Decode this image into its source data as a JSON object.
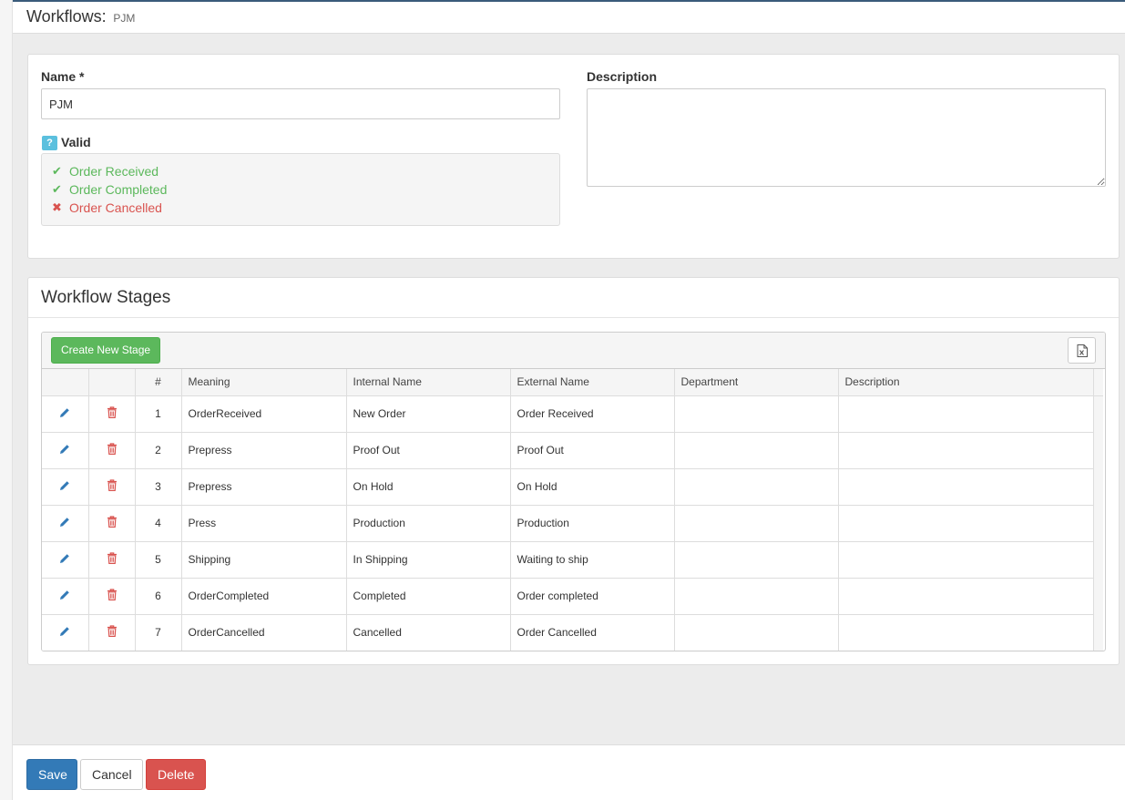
{
  "header": {
    "title": "Workflows:",
    "subtitle": "PJM"
  },
  "form": {
    "name_label": "Name *",
    "name_value": "PJM",
    "description_label": "Description",
    "description_value": "",
    "valid_badge": "?",
    "valid_label": "Valid",
    "validations": [
      {
        "label": "Order Received",
        "status": "ok"
      },
      {
        "label": "Order Completed",
        "status": "ok"
      },
      {
        "label": "Order Cancelled",
        "status": "fail"
      }
    ]
  },
  "stages": {
    "title": "Workflow Stages",
    "create_label": "Create New Stage",
    "columns": [
      "#",
      "Meaning",
      "Internal Name",
      "External Name",
      "Department",
      "Description"
    ],
    "rows": [
      {
        "num": "1",
        "meaning": "OrderReceived",
        "internal": "New Order",
        "external": "Order Received",
        "department": "",
        "description": ""
      },
      {
        "num": "2",
        "meaning": "Prepress",
        "internal": "Proof Out",
        "external": "Proof Out",
        "department": "",
        "description": ""
      },
      {
        "num": "3",
        "meaning": "Prepress",
        "internal": "On Hold",
        "external": "On Hold",
        "department": "",
        "description": ""
      },
      {
        "num": "4",
        "meaning": "Press",
        "internal": "Production",
        "external": "Production",
        "department": "",
        "description": ""
      },
      {
        "num": "5",
        "meaning": "Shipping",
        "internal": "In Shipping",
        "external": "Waiting to ship",
        "department": "",
        "description": ""
      },
      {
        "num": "6",
        "meaning": "OrderCompleted",
        "internal": "Completed",
        "external": "Order completed",
        "department": "",
        "description": ""
      },
      {
        "num": "7",
        "meaning": "OrderCancelled",
        "internal": "Cancelled",
        "external": "Order Cancelled",
        "department": "",
        "description": ""
      }
    ]
  },
  "footer": {
    "save": "Save",
    "cancel": "Cancel",
    "delete": "Delete"
  },
  "colors": {
    "primary": "#337ab7",
    "success": "#5cb85c",
    "danger": "#d9534f",
    "info": "#5bc0de"
  },
  "icons": {
    "edit": "pencil-icon",
    "delete": "trash-icon",
    "export": "excel-icon",
    "ok": "check-icon",
    "fail": "cross-icon"
  }
}
